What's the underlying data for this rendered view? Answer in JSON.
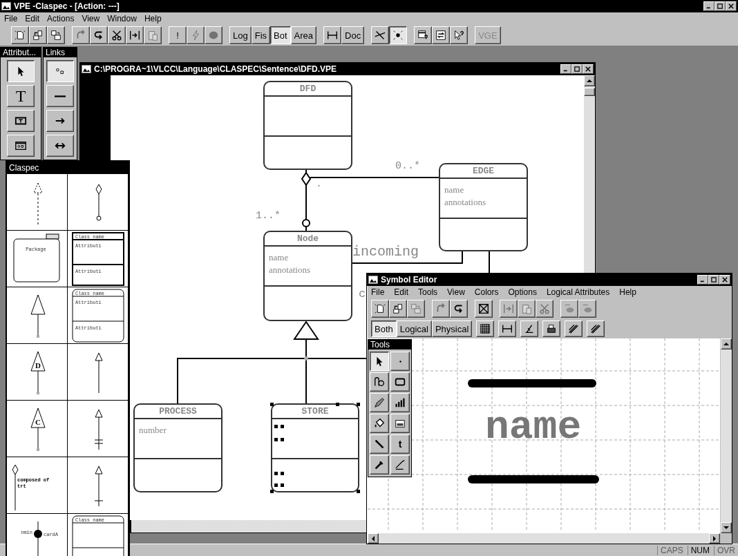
{
  "app_window": {
    "title": "VPE -Claspec - [Action: ---]"
  },
  "menu": [
    "File",
    "Edit",
    "Actions",
    "View",
    "Window",
    "Help"
  ],
  "toolbar": [
    [
      {
        "kind": "icon",
        "selected": false,
        "disabled": false
      },
      {
        "kind": "icon",
        "selected": false,
        "disabled": false
      },
      {
        "kind": "icon",
        "selected": false,
        "disabled": false
      }
    ],
    [
      {
        "kind": "icon",
        "selected": false,
        "disabled": true
      },
      {
        "kind": "icon",
        "selected": false,
        "disabled": false
      },
      {
        "kind": "icon",
        "selected": false,
        "disabled": false
      },
      {
        "kind": "icon",
        "selected": false,
        "disabled": false
      },
      {
        "kind": "icon",
        "selected": false,
        "disabled": true
      }
    ],
    [
      {
        "kind": "text",
        "label": "!",
        "selected": false,
        "disabled": false
      },
      {
        "kind": "icon",
        "selected": false,
        "disabled": true
      },
      {
        "kind": "icon",
        "selected": false,
        "disabled": true
      }
    ],
    [
      {
        "kind": "text",
        "label": "Log",
        "selected": false,
        "disabled": false
      },
      {
        "kind": "text",
        "label": "Fis",
        "selected": false,
        "disabled": false
      },
      {
        "kind": "text",
        "label": "Bot",
        "selected": true,
        "disabled": false
      },
      {
        "kind": "text",
        "label": "Area",
        "selected": false,
        "disabled": false
      }
    ],
    [
      {
        "kind": "icon",
        "selected": false,
        "disabled": false
      },
      {
        "kind": "text",
        "label": "Doc",
        "selected": false,
        "disabled": false
      }
    ],
    [
      {
        "kind": "icon",
        "selected": false,
        "disabled": false
      },
      {
        "kind": "icon",
        "selected": true,
        "disabled": false
      }
    ],
    [
      {
        "kind": "icon",
        "selected": false,
        "disabled": false
      },
      {
        "kind": "icon",
        "selected": false,
        "disabled": false
      },
      {
        "kind": "icon",
        "selected": false,
        "disabled": false
      }
    ],
    [
      {
        "kind": "text",
        "label": "VGE",
        "selected": false,
        "disabled": true
      }
    ]
  ],
  "attribute_palette": {
    "title": "Attribut...",
    "tools": [
      {
        "kind": "icon",
        "selected": true
      },
      {
        "kind": "text",
        "label": "T",
        "selected": false
      },
      {
        "kind": "icon",
        "selected": false
      },
      {
        "kind": "icon",
        "selected": false
      }
    ]
  },
  "links_palette": {
    "title": "Links",
    "tools": [
      {
        "kind": "icon",
        "selected": true
      },
      {
        "kind": "icon",
        "selected": false
      },
      {
        "kind": "icon",
        "selected": false
      },
      {
        "kind": "icon",
        "selected": false
      }
    ]
  },
  "claspec_palette": {
    "title": "Claspec",
    "cells": [
      {
        "kind": "dependency"
      },
      {
        "kind": "aggregation"
      },
      {
        "kind": "package",
        "texts": [
          "Package"
        ]
      },
      {
        "kind": "class-square",
        "texts": [
          "Class name",
          "Attributi",
          "Attributi"
        ]
      },
      {
        "kind": "generalization"
      },
      {
        "kind": "class-rounded",
        "texts": [
          "Class name",
          "Attributi",
          "Attributi"
        ]
      },
      {
        "kind": "generalization",
        "texts": [
          "D"
        ]
      },
      {
        "kind": "arrow"
      },
      {
        "kind": "generalization",
        "texts": [
          "C"
        ]
      },
      {
        "kind": "arrow-double-bar"
      },
      {
        "kind": "composition",
        "texts": [
          "composed of",
          "trt"
        ]
      },
      {
        "kind": "arrow-bar"
      },
      {
        "kind": "cardinality",
        "texts": [
          "nmin",
          "cardA"
        ]
      },
      {
        "kind": "class-rounded",
        "texts": [
          "Class name"
        ]
      }
    ]
  },
  "diagram_window": {
    "title": "C:\\PROGRA~1\\VLCC\\Language\\CLASPEC\\Sentence\\DFD.VPE",
    "classes": [
      {
        "name": "DFD",
        "selected": false
      },
      {
        "name": "EDGE",
        "attributes": [
          "name",
          "annotations"
        ],
        "selected": false
      },
      {
        "name": "Node",
        "attributes": [
          "name",
          "annotations"
        ],
        "selected": false
      },
      {
        "name": "PROCESS",
        "attributes": [
          "number"
        ],
        "selected": false
      },
      {
        "name": "STORE",
        "selected": true
      }
    ],
    "labels": [
      "0..*",
      "1..*",
      ".",
      "incoming",
      "c"
    ]
  },
  "symbol_editor": {
    "title": "Symbol Editor",
    "menu": [
      "File",
      "Edit",
      "Tools",
      "View",
      "Colors",
      "Options",
      "Logical Attributes",
      "Help"
    ],
    "toolbar_1": [
      [
        {
          "kind": "icon",
          "selected": false,
          "disabled": false
        },
        {
          "kind": "icon",
          "selected": false,
          "disabled": false
        },
        {
          "kind": "icon",
          "selected": false,
          "disabled": true
        }
      ],
      [
        {
          "kind": "icon",
          "selected": false,
          "disabled": true
        },
        {
          "kind": "icon",
          "selected": false,
          "disabled": false
        }
      ],
      [
        {
          "kind": "icon",
          "selected": false,
          "disabled": false
        }
      ],
      [
        {
          "kind": "icon",
          "selected": false,
          "disabled": true
        },
        {
          "kind": "icon",
          "selected": false,
          "disabled": true
        },
        {
          "kind": "icon",
          "selected": false,
          "disabled": true
        }
      ],
      [
        {
          "kind": "icon",
          "selected": false,
          "disabled": true
        },
        {
          "kind": "icon",
          "selected": false,
          "disabled": true
        }
      ]
    ],
    "toolbar_2": [
      [
        {
          "kind": "text",
          "label": "Both",
          "selected": true,
          "disabled": false
        },
        {
          "kind": "text",
          "label": "Logical",
          "selected": false,
          "disabled": false
        },
        {
          "kind": "text",
          "label": "Physical",
          "selected": false,
          "disabled": false
        }
      ],
      [
        {
          "kind": "icon",
          "selected": false,
          "disabled": false
        }
      ],
      [
        {
          "kind": "icon",
          "selected": false,
          "disabled": false
        }
      ],
      [
        {
          "kind": "icon",
          "selected": false,
          "disabled": false
        }
      ],
      [
        {
          "kind": "icon",
          "selected": false,
          "disabled": false
        }
      ],
      [
        {
          "kind": "icon",
          "selected": false,
          "disabled": false
        }
      ],
      [
        {
          "kind": "icon",
          "selected": false,
          "disabled": false
        }
      ]
    ],
    "tools_title": "Tools",
    "tools": [
      {
        "kind": "icon",
        "selected": true
      },
      {
        "kind": "icon",
        "selected": false
      },
      {
        "kind": "icon",
        "selected": false
      },
      {
        "kind": "icon",
        "selected": false
      },
      {
        "kind": "icon",
        "selected": false
      },
      {
        "kind": "icon",
        "selected": false
      },
      {
        "kind": "icon",
        "selected": false
      },
      {
        "kind": "icon",
        "selected": false
      },
      {
        "kind": "icon",
        "selected": false
      },
      {
        "kind": "text",
        "label": "t",
        "selected": false
      },
      {
        "kind": "icon",
        "selected": false
      },
      {
        "kind": "icon",
        "selected": false
      }
    ],
    "symbol": {
      "text": "name"
    }
  },
  "status_bar": [
    {
      "label": "CAPS",
      "on": false
    },
    {
      "label": "NUM",
      "on": true
    },
    {
      "label": "OVR",
      "on": false
    }
  ]
}
